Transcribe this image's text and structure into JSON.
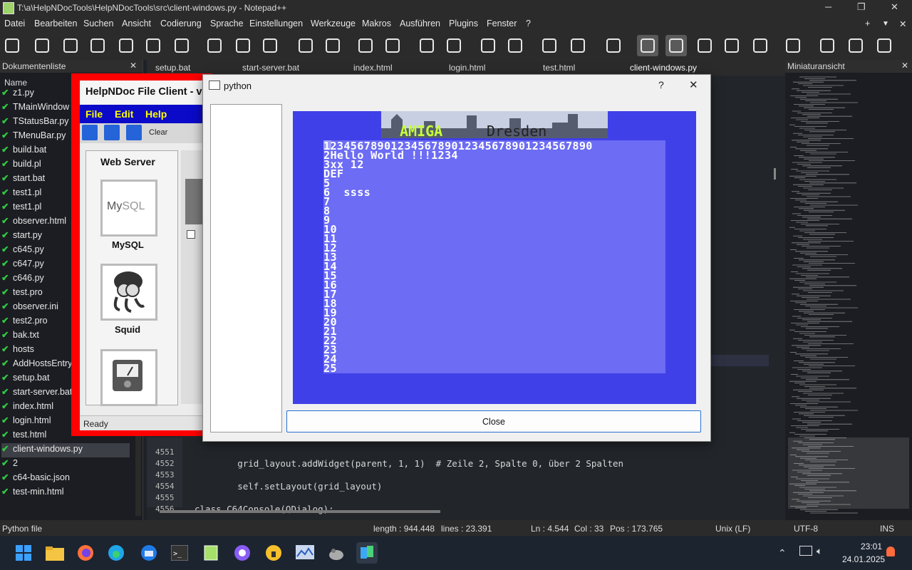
{
  "window": {
    "title": "T:\\a\\HelpNDocTools\\HelpNDocTools\\src\\client-windows.py - Notepad++"
  },
  "menu": [
    "Datei",
    "Bearbeiten",
    "Suchen",
    "Ansicht",
    "Codierung",
    "Sprache",
    "Einstellungen",
    "Werkzeuge",
    "Makros",
    "Ausführen",
    "Plugins",
    "Fenster",
    "?"
  ],
  "menu_right": [
    "+",
    "▼",
    "✕"
  ],
  "toolbar_icons": [
    "new-icon",
    "open-icon",
    "save-icon",
    "save-all-icon",
    "close-icon",
    "close-all-icon",
    "print-icon",
    "cut-icon",
    "copy-icon",
    "paste-icon",
    "undo-icon",
    "redo-icon",
    "find-icon",
    "replace-icon",
    "zoom-in-icon",
    "zoom-out-icon",
    "sync-v-icon",
    "sync-h-icon",
    "wrap-icon",
    "show-all-chars-icon",
    "indent-guide-icon",
    "udl-icon",
    "doc-map-icon",
    "doc-list-icon",
    "function-list-icon",
    "folder-workspace-icon",
    "monitoring-icon",
    "record-macro-icon",
    "stop-macro-icon",
    "play-macro-icon"
  ],
  "doc_list": {
    "title": "Dokumentenliste",
    "column": "Name",
    "items": [
      "z1.py",
      "TMainWindow",
      "TStatusBar.py",
      "TMenuBar.py",
      "build.bat",
      "build.pl",
      "start.bat",
      "test1.pl",
      "test1.pl",
      "observer.html",
      "start.py",
      "c645.py",
      "c647.py",
      "c646.py",
      "test.pro",
      "observer.ini",
      "test2.pro",
      "bak.txt",
      "hosts",
      "AddHostsEntry",
      "setup.bat",
      "start-server.bat",
      "index.html",
      "login.html",
      "test.html",
      "client-windows.py",
      "2",
      "c64-basic.json",
      "test-min.html"
    ],
    "selected": "client-windows.py"
  },
  "tabs": [
    "setup.bat",
    "start-server.bat",
    "index.html",
    "login.html",
    "test.html",
    "client-windows.py"
  ],
  "editor": {
    "lines": [
      {
        "num": "4551",
        "text": ""
      },
      {
        "num": "4552",
        "text": "        grid_layout.addWidget(parent, 1, 1)  # Zeile 2, Spalte 0, über 2 Spalten"
      },
      {
        "num": "4553",
        "text": ""
      },
      {
        "num": "4554",
        "text": "        self.setLayout(grid_layout)"
      },
      {
        "num": "4555",
        "text": ""
      },
      {
        "num": "4556",
        "text": "class C64Console(QDialog):"
      }
    ]
  },
  "minimap": {
    "title": "Miniaturansicht"
  },
  "status": {
    "filetype": "Python file",
    "length": "length : 944.448",
    "lines": "lines : 23.391",
    "ln": "Ln : 4.544",
    "col": "Col : 33",
    "pos": "Pos : 173.765",
    "eol": "Unix (LF)",
    "encoding": "UTF-8",
    "mode": "INS"
  },
  "helpndoc": {
    "title": "HelpNDoc File Client - v",
    "menu": [
      "File",
      "Edit",
      "Help"
    ],
    "toolbar_clear": "Clear",
    "section": "Web Server",
    "items": [
      "MySQL",
      "Squid"
    ],
    "status": "Ready"
  },
  "python_dialog": {
    "title": "python",
    "help_btn": "?",
    "close_x": "✕",
    "banner_text_a": "AMIGA",
    "banner_text_b": "Dresden",
    "c64_lines": [
      "1234567890123456789012345678901234567890",
      "2Hello World !!!1234",
      "3xx 12",
      "DEF",
      "5",
      "6  ssss",
      "7",
      "8",
      "9",
      "10",
      "11",
      "12",
      "13",
      "14",
      "15",
      "16",
      "17",
      "18",
      "19",
      "20",
      "21",
      "22",
      "23",
      "24",
      "25"
    ],
    "close_button": "Close"
  },
  "taskbar": {
    "time": "23:01",
    "date": "24.01.2025"
  },
  "colors": {
    "accent_red": "#ff0000",
    "c64_border": "#4040e8",
    "c64_screen": "#6c6cf4"
  }
}
